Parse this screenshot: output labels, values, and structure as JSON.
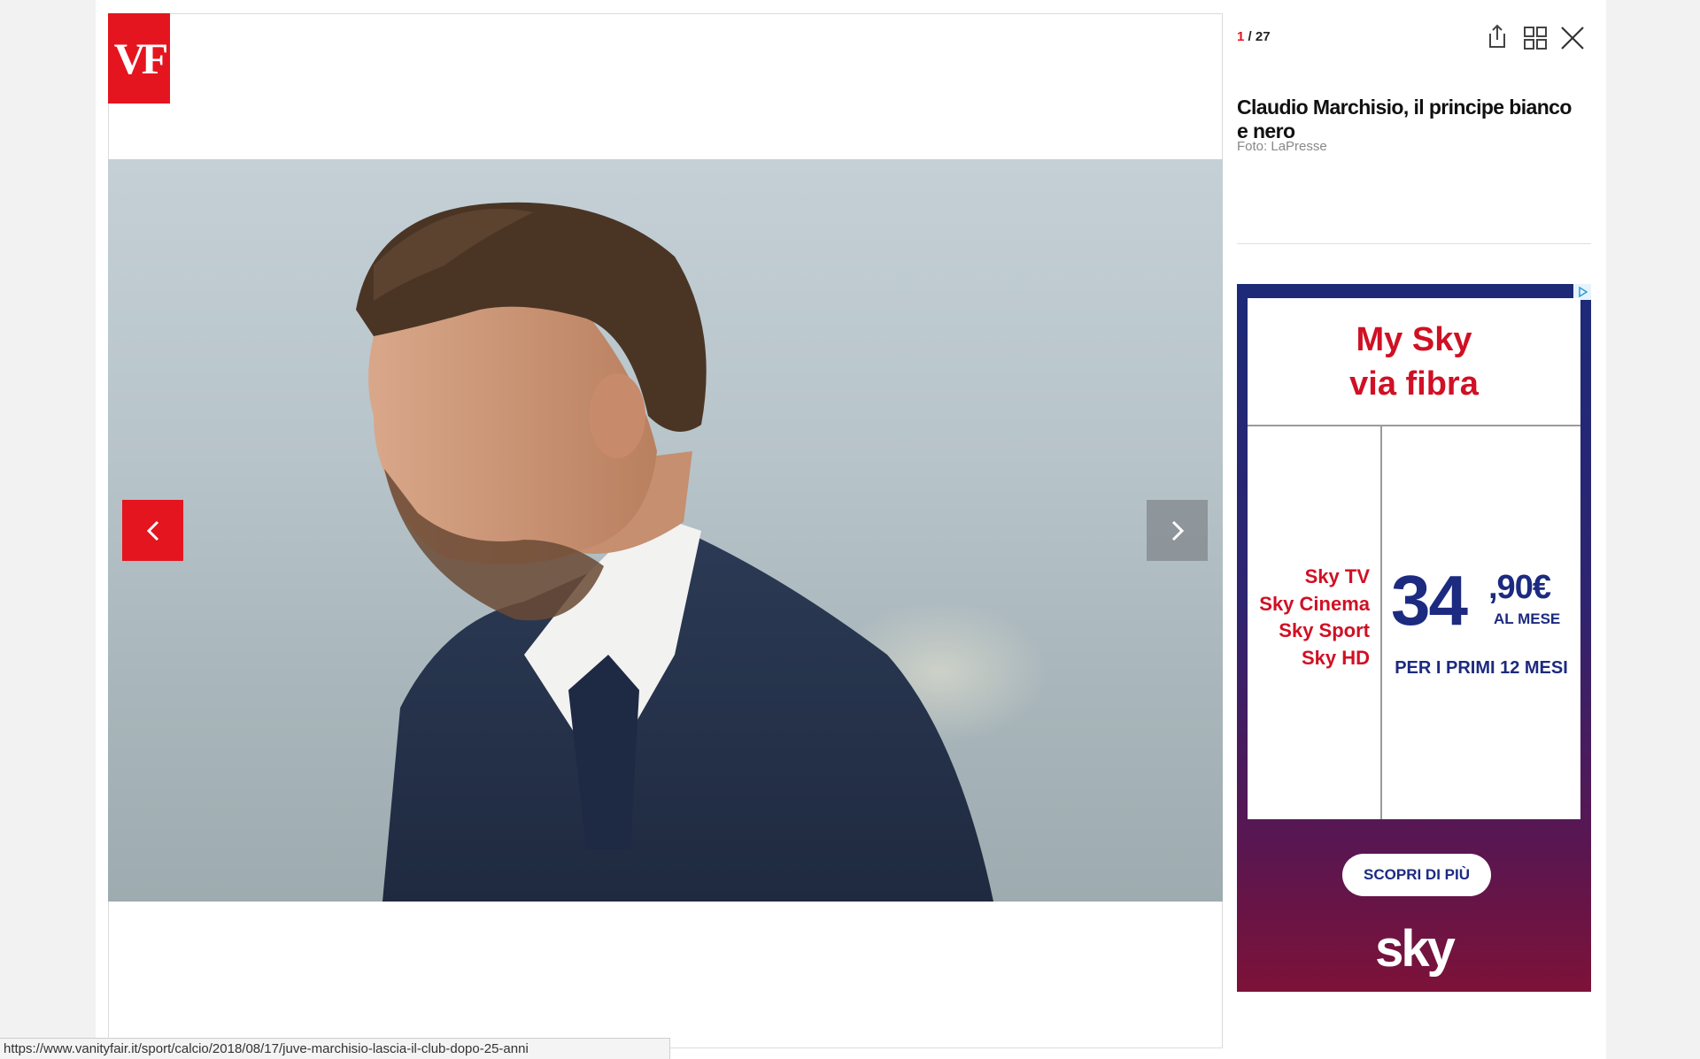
{
  "logo": {
    "text": "VF"
  },
  "gallery": {
    "counter_current": "1",
    "counter_sep": " / ",
    "counter_total": "27",
    "photo_alt": "Claudio Marchisio",
    "prev_icon": "chevron-left-icon",
    "next_icon": "chevron-right-icon"
  },
  "toolbar": {
    "share_icon": "share-icon",
    "grid_icon": "grid-icon",
    "close_icon": "close-icon"
  },
  "caption": {
    "title": "Claudio Marchisio, il principe bianco e nero",
    "credit": "Foto: LaPresse"
  },
  "ad": {
    "headline_line1": "My Sky",
    "headline_line2": "via fibra",
    "channels": [
      "Sky TV",
      "Sky Cinema",
      "Sky Sport",
      "Sky HD"
    ],
    "price_whole": "34",
    "price_cents": ",90€",
    "price_period": "AL MESE",
    "price_note": "PER I PRIMI 12 MESI",
    "cta": "SCOPRI DI PIÙ",
    "brand": "sky",
    "colors": {
      "red": "#d01024",
      "navy": "#1c2a80"
    }
  },
  "status_bar": {
    "url": "https://www.vanityfair.it/sport/calcio/2018/08/17/juve-marchisio-lascia-il-club-dopo-25-anni"
  },
  "colors": {
    "brand_red": "#e4151f"
  }
}
